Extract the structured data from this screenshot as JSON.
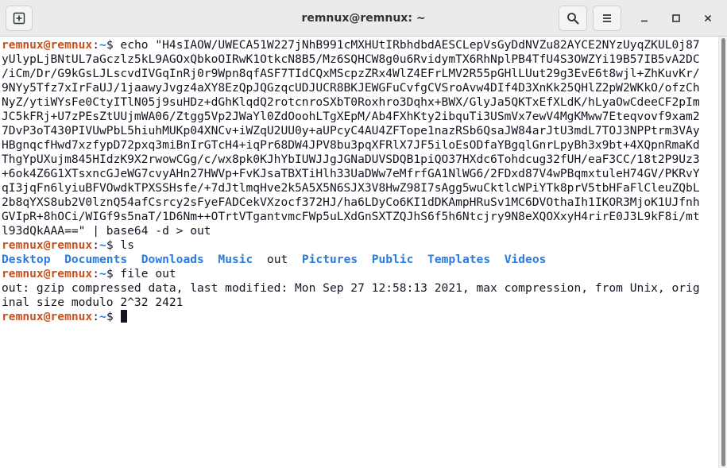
{
  "window": {
    "title": "remnux@remnux: ~"
  },
  "icons": {
    "new_tab": "new-tab-icon",
    "search": "search-icon",
    "menu": "hamburger-menu-icon",
    "minimize": "minimize-icon",
    "maximize": "maximize-icon",
    "close": "close-icon"
  },
  "colors": {
    "prompt_user": "#c7511f",
    "prompt_path": "#2a7bde",
    "directory": "#2a7bde",
    "text": "#171421",
    "background": "#ffffff"
  },
  "prompt": {
    "user": "remnux@remnux",
    "sep": ":",
    "path": "~",
    "symbol": "$ "
  },
  "terminal": {
    "cmd1": [
      "echo \"H4sIAOW/UWECA51W227jNhB991cMXHUtIRbhdbdAESCLepVsGyDdNVZu82AYCE2NYzUyqZKUL0j87",
      "yUlypLjBNtUL7aGczlz5kL9AGOxQbkoOIRwK1OtkcN8B5/Mz6SQHCW8g0u6RvidymTX6RhNplPB4TfU4S3OWZYi19B57IB5vA2DC",
      "/iCm/Dr/G9kGsLJLscvdIVGqInRj0r9Wpn8qfASF7TIdCQxMScpzZRx4WlZ4EFrLMV2R55pGHlLUut29g3EvE6t8wjl+ZhKuvKr/",
      "9NYy5Tfz7xIrFaUJ/1jaawyJvgz4aXY8EzQpJQGzqcUDJUCR8BKJEWGFuCvfgCVSroAvw4DIf4D3XnKk25QHlZ2pW2WKkO/ofzCh",
      "NyZ/ytiWYsFe0CtyITlN05j9suHDz+dGhKlqdQ2rotcnroSXbT0Roxhro3Dqhx+BWX/GlyJa5QKTxEfXLdK/hLyaOwCdeeCF2pIm",
      "JC5kFRj+U7zPEsZtUUjmWA06/Ztgg5Vp2JWaYl0ZdOoohLTgXEpM/Ab4FXhKty2ibquTi3USmVx7ewV4MgKMww7Eteqvovf9xam2",
      "7DvP3oT430PIVUwPbL5hiuhMUKp04XNCv+iWZqU2UU0y+aUPcyC4AU4ZFTope1nazRSb6QsaJW84arJtU3mdL7TOJ3NPPtrm3VAy",
      "HBgnqcfHwd7xzfypD72pxq3miBnIrGTcH4+iqPr68DW4JPV8bu3pqXFRlX7JF5iloEsODfaYBgqlGnrLpyBh3x9bt+4XQpnRmaKd",
      "ThgYpUXujm845HIdzK9X2rwowCGg/c/wx8pk0KJhYbIUWJJgJGNaDUVSDQB1piQO37HXdc6Tohdcug32fUH/eaF3CC/18t2P9Uz3",
      "+6ok4Z6G1XTsxncGJeWG7cvyAHn27HWVp+FvKJsaTBXTiHlh33UaDWw7eMfrfGA1NlWG6/2FDxd87V4wPBqmxtuleH74GV/PKRvY",
      "qI3jqFn6lyiuBFVOwdkTPXSSHsfe/+7dJtlmqHve2k5A5X5N6SJX3V8HwZ98I7sAgg5wuCktlcWPiYTk8prV5tbHFaFlCleuZQbL",
      "2b8qYXS8ub2V0lznQ54afCsrcy2sFyeFADCekVXzocf372HJ/ha6LDyCo6KI1dDKAmpHRuSv1MC6DVOthaIh1IKOR3MjoK1UJfnh",
      "GVIpR+8hOCi/WIGf9s5naT/1D6Nm++OTrtVTgantvmcFWp5uLXdGnSXTZQJhS6f5h6Ntcjry9N8eXQOXxyH4rirE0J3L9kF8i/mt",
      "l93dQkAAA==\" | base64 -d > out"
    ],
    "cmd2": "ls",
    "ls_items": [
      "Desktop",
      "Documents",
      "Downloads",
      "Music",
      "out",
      "Pictures",
      "Public",
      "Templates",
      "Videos"
    ],
    "cmd3": "file out",
    "file_output": [
      "out: gzip compressed data, last modified: Mon Sep 27 12:58:13 2021, max compression, from Unix, orig",
      "inal size modulo 2^32 2421"
    ]
  }
}
